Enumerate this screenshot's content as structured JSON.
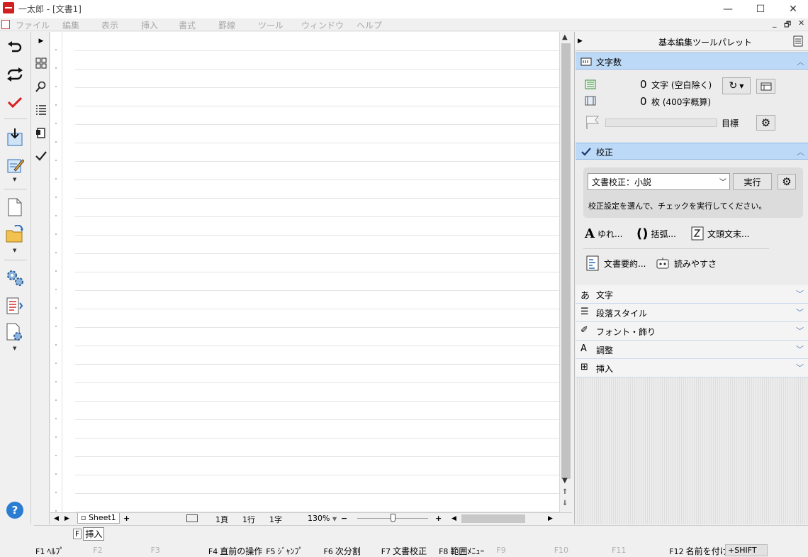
{
  "window": {
    "title": "一太郎 - [文書1]",
    "minimize": "—",
    "maximize": "☐",
    "close": "✕"
  },
  "menu": {
    "items": [
      "ファイル",
      "編集",
      "表示",
      "挿入",
      "書式",
      "罫線",
      "ツール",
      "ウィンドウ",
      "ヘルプ"
    ],
    "mdi_min": "_",
    "mdi_restore": "🗗",
    "mdi_close": "✕"
  },
  "status": {
    "sheet": "Sheet1",
    "add_sheet": "+",
    "page": "1頁",
    "line": "1行",
    "char": "1字",
    "zoom": "130%",
    "zoom_minus": "−",
    "zoom_plus": "+"
  },
  "palette": {
    "title": "基本編集ツールパレット",
    "word_count": {
      "header": "文字数",
      "chars_value": "0",
      "chars_label": "文字 (空白除く)",
      "sheets_value": "0",
      "sheets_label": "枚 (400字概算)",
      "goal_label": "目標",
      "goal_progress": 0
    },
    "proofread": {
      "header": "校正",
      "mode": "文書校正：小説",
      "run_label": "実行",
      "hint": "校正設定を選んで、チェックを実行してください。",
      "tools": [
        "ゆれ...",
        "括弧...",
        "文頭文末...",
        "文書要約...",
        "読みやすさ"
      ]
    },
    "sections": [
      {
        "icon": "あ",
        "label": "文字"
      },
      {
        "icon": "☰",
        "label": "段落スタイル"
      },
      {
        "icon": "✐",
        "label": "フォント・飾り"
      },
      {
        "icon": "A",
        "label": "調整"
      },
      {
        "icon": "⊞",
        "label": "挿入"
      }
    ]
  },
  "fkeys": {
    "mode_key": "F",
    "mode_label": "挿入",
    "keys": [
      {
        "n": "F1",
        "t": "ﾍﾙﾌﾟ"
      },
      {
        "n": "F2",
        "t": ""
      },
      {
        "n": "F3",
        "t": ""
      },
      {
        "n": "F4",
        "t": "直前の操作"
      },
      {
        "n": "F5",
        "t": "ｼﾞｬﾝﾌﾟ"
      },
      {
        "n": "F6",
        "t": "次分割"
      },
      {
        "n": "F7",
        "t": "文書校正"
      },
      {
        "n": "F8",
        "t": "範囲ﾒﾆｭｰ"
      },
      {
        "n": "F9",
        "t": ""
      },
      {
        "n": "F10",
        "t": ""
      },
      {
        "n": "F11",
        "t": ""
      },
      {
        "n": "F12",
        "t": "名前を付け"
      }
    ],
    "shift_label": "+SHIFT"
  }
}
